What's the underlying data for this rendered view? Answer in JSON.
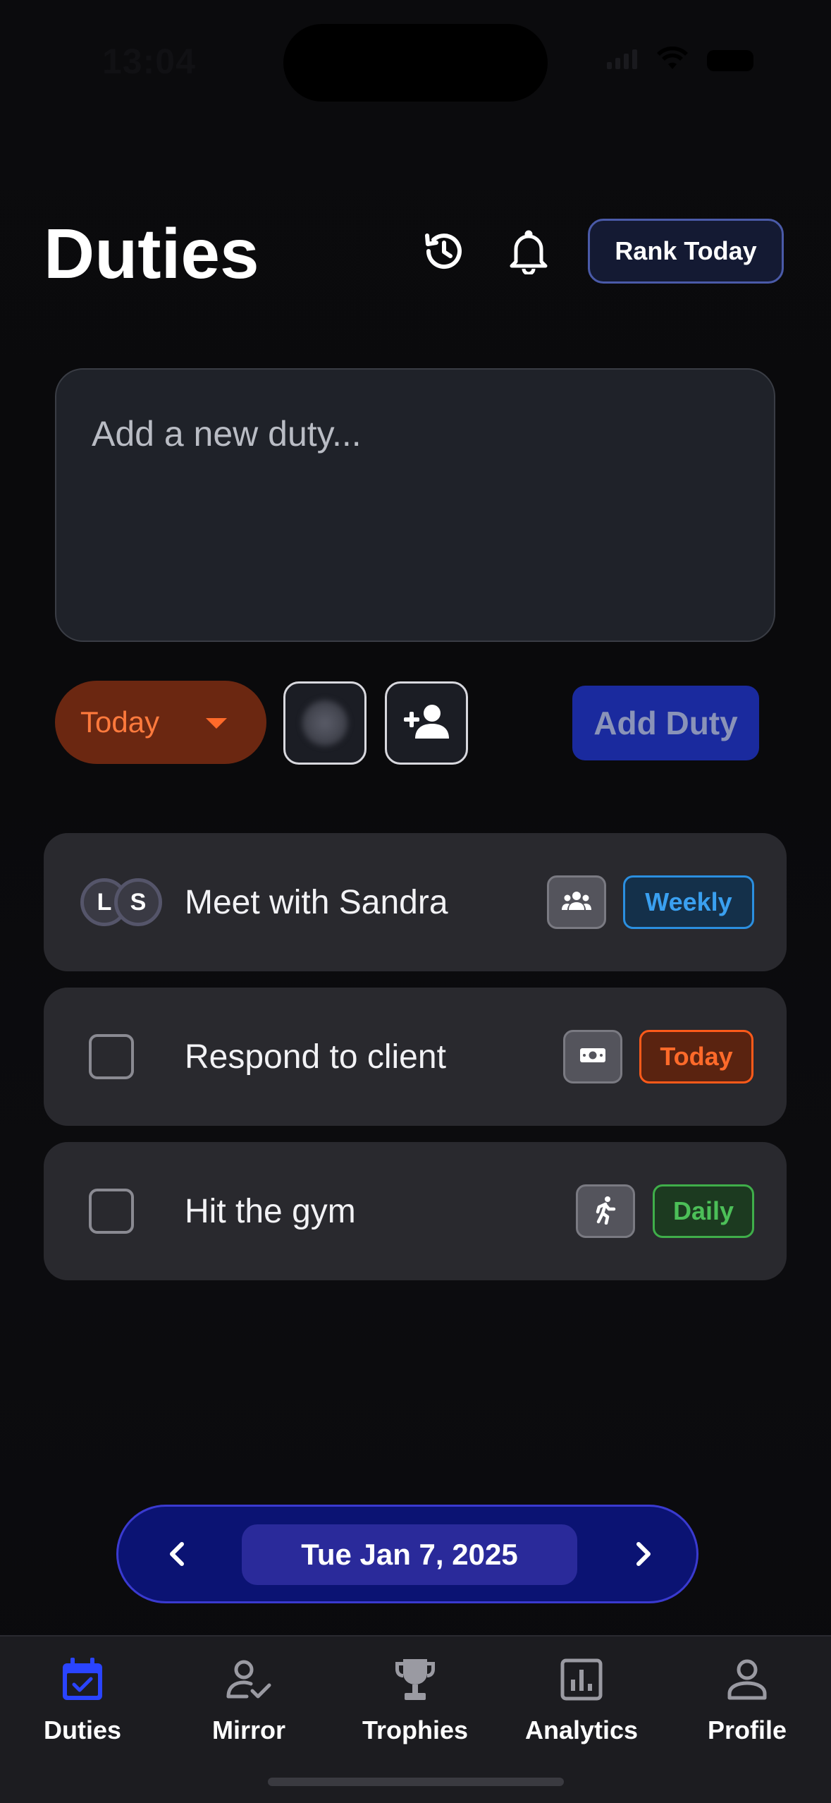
{
  "status_bar": {
    "time": "13:04"
  },
  "header": {
    "title": "Duties",
    "rank_button_label": "Rank Today"
  },
  "composer": {
    "placeholder": "Add a new duty...",
    "due_selected": "Today",
    "add_button_label": "Add Duty"
  },
  "duties": [
    {
      "title": "Meet with Sandra",
      "assignees": [
        "L",
        "S"
      ],
      "category_icon": "group-icon",
      "frequency": "Weekly",
      "frequency_color": "#3aa0f0"
    },
    {
      "title": "Respond to client",
      "category_icon": "money-icon",
      "frequency": "Today",
      "frequency_color": "#ff6a2a"
    },
    {
      "title": "Hit the gym",
      "category_icon": "running-icon",
      "frequency": "Daily",
      "frequency_color": "#4cbf58"
    }
  ],
  "date_nav": {
    "date": "Tue Jan 7, 2025"
  },
  "tabs": [
    {
      "label": "Duties",
      "icon": "calendar-check-icon",
      "active": true
    },
    {
      "label": "Mirror",
      "icon": "person-check-icon",
      "active": false
    },
    {
      "label": "Trophies",
      "icon": "trophy-icon",
      "active": false
    },
    {
      "label": "Analytics",
      "icon": "bar-chart-icon",
      "active": false
    },
    {
      "label": "Profile",
      "icon": "person-icon",
      "active": false
    }
  ],
  "colors": {
    "accent": "#2a44ff",
    "today_orange": "#ff6a2a",
    "weekly_blue": "#3aa0f0",
    "daily_green": "#4cbf58"
  }
}
